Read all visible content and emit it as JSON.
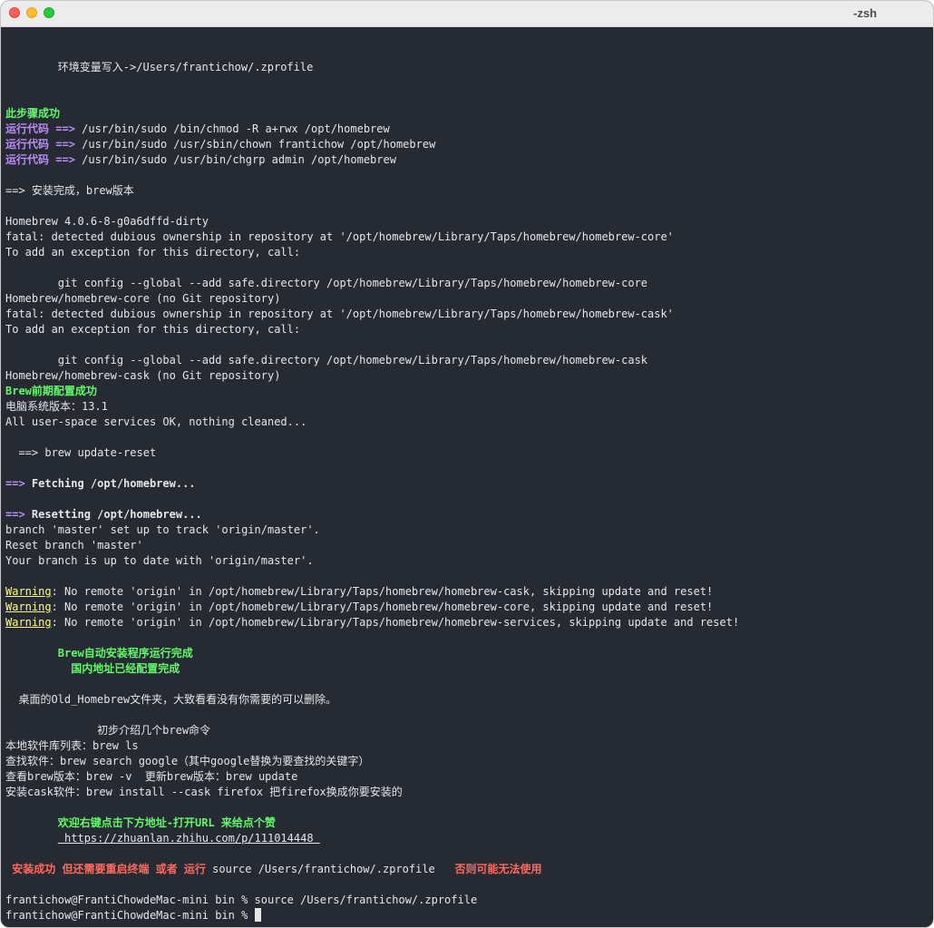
{
  "window": {
    "title": "-zsh"
  },
  "lines": {
    "env_write": "        环境变量写入->/Users/frantichow/.zprofile",
    "step_success": "此步骤成功",
    "run_label": "运行代码",
    "arrow": "==>",
    "run1_cmd": " /usr/bin/sudo /bin/chmod -R a+rwx /opt/homebrew",
    "run2_cmd": " /usr/bin/sudo /usr/sbin/chown frantichow /opt/homebrew",
    "run3_cmd": " /usr/bin/sudo /usr/bin/chgrp admin /opt/homebrew",
    "install_done": "==> 安装完成，brew版本",
    "brew_version": "Homebrew 4.0.6-8-g0a6dffd-dirty",
    "fatal_core": "fatal: detected dubious ownership in repository at '/opt/homebrew/Library/Taps/homebrew/homebrew-core'",
    "add_exception_1": "To add an exception for this directory, call:",
    "git_config_core": "        git config --global --add safe.directory /opt/homebrew/Library/Taps/homebrew/homebrew-core",
    "core_no_git": "Homebrew/homebrew-core (no Git repository)",
    "fatal_cask": "fatal: detected dubious ownership in repository at '/opt/homebrew/Library/Taps/homebrew/homebrew-cask'",
    "add_exception_2": "To add an exception for this directory, call:",
    "git_config_cask": "        git config --global --add safe.directory /opt/homebrew/Library/Taps/homebrew/homebrew-cask",
    "cask_no_git": "Homebrew/homebrew-cask (no Git repository)",
    "brew_pre_config": "Brew前期配置成功",
    "os_version": "电脑系统版本：13.1",
    "services_ok": "All user-space services OK, nothing cleaned...",
    "update_reset": "  ==> brew update-reset",
    "fetching_text": " Fetching /opt/homebrew...",
    "resetting_text": " Resetting /opt/homebrew...",
    "branch_track": "branch 'master' set up to track 'origin/master'.",
    "reset_branch": "Reset branch 'master'",
    "up_to_date": "Your branch is up to date with 'origin/master'.",
    "warning_label": "Warning",
    "warn_cask": ": No remote 'origin' in /opt/homebrew/Library/Taps/homebrew/homebrew-cask, skipping update and reset!",
    "warn_core": ": No remote 'origin' in /opt/homebrew/Library/Taps/homebrew/homebrew-core, skipping update and reset!",
    "warn_services": ": No remote 'origin' in /opt/homebrew/Library/Taps/homebrew/homebrew-services, skipping update and reset!",
    "auto_install_done": "        Brew自动安装程序运行完成",
    "mirror_done": "          国内地址已经配置完成",
    "old_folder": "  桌面的Old_Homebrew文件夹，大致看看没有你需要的可以删除。",
    "intro_cmds": "              初步介绍几个brew命令",
    "cmd_ls": "本地软件库列表：brew ls",
    "cmd_search": "查找软件：brew search google（其中google替换为要查找的关键字）",
    "cmd_version": "查看brew版本：brew -v  更新brew版本：brew update",
    "cmd_cask": "安装cask软件：brew install --cask firefox 把firefox换成你要安装的",
    "welcome": "        欢迎右键点击下方地址-打开URL 来给点个赞",
    "url_indent": "        ",
    "url": " https://zhuanlan.zhihu.com/p/111014448 ",
    "success_prefix": " 安装成功 但还需要重启终端 或者 运行",
    "success_cmd": " source /Users/frantichow/.zprofile ",
    "success_suffix": "  否则可能无法使用",
    "prompt_1": "frantichow@FrantiChowdeMac-mini bin % source /Users/frantichow/.zprofile",
    "prompt_2": "frantichow@FrantiChowdeMac-mini bin % "
  }
}
